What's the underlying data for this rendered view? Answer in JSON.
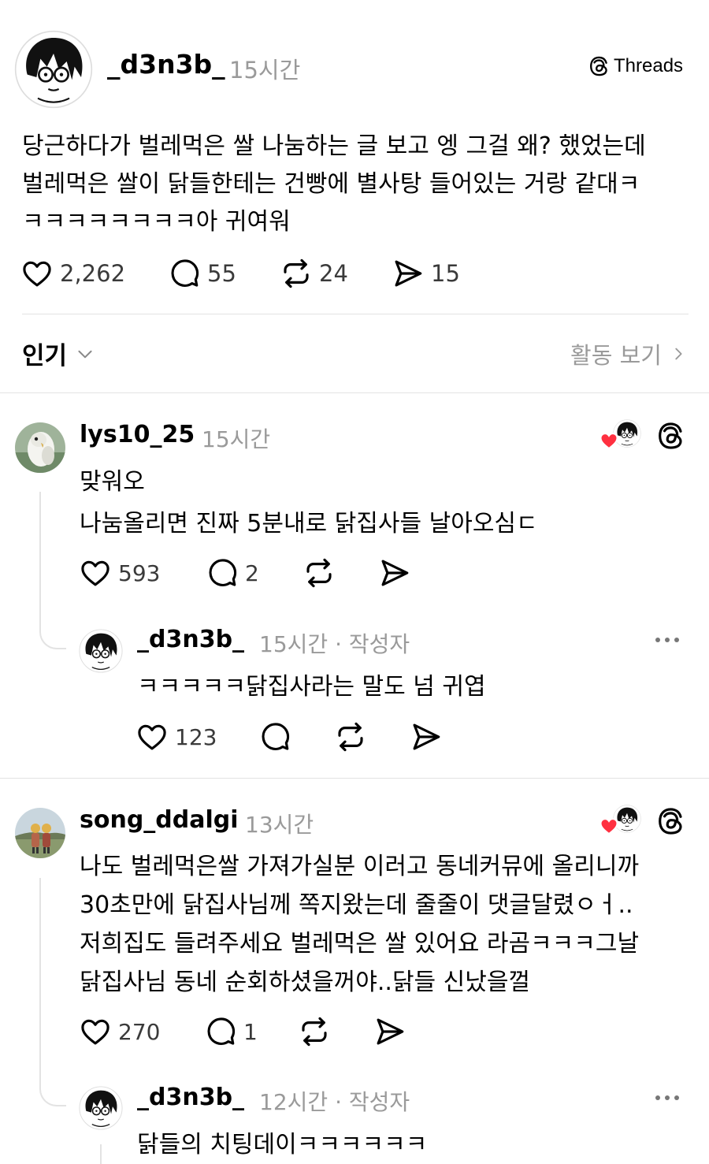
{
  "post": {
    "username": "_d3n3b_",
    "time": "15시간",
    "brand": "Threads",
    "lines": [
      "당근하다가 벌레먹은 쌀 나눔하는 글 보고 엥 그걸 왜? 했었는데",
      "벌레먹은 쌀이 닭들한테는 건빵에 별사탕 들어있는 거랑 같대ㅋ",
      "ㅋㅋㅋㅋㅋㅋㅋㅋ아 귀여워"
    ],
    "likes": "2,262",
    "replies": "55",
    "reposts": "24",
    "shares": "15"
  },
  "sort": {
    "label": "인기",
    "activity_link": "활동 보기"
  },
  "comments": [
    {
      "username": "lys10_25",
      "time": "15시간",
      "lines": [
        "맞워오",
        "나눔올리면 진짜 5분내로 닭집사들 날아오심ㄷ"
      ],
      "likes": "593",
      "replies": "2",
      "reply": {
        "username": "_d3n3b_",
        "time": "15시간",
        "author_tag": "· 작성자",
        "lines": [
          "ㅋㅋㅋㅋㅋ닭집사라는 말도 넘 귀엽"
        ],
        "likes": "123"
      }
    },
    {
      "username": "song_ddalgi",
      "time": "13시간",
      "lines": [
        "나도 벌레먹은쌀 가져가실분 이러고 동네커뮤에 올리니까",
        "30초만에 닭집사님께 쪽지왔는데 줄줄이 댓글달렸ㅇㅓ..",
        "저희집도 들려주세요 벌레먹은 쌀 있어요 라곰ㅋㅋㅋ그날",
        "닭집사님 동네 순회하셨을꺼야..닭들 신났을껄"
      ],
      "likes": "270",
      "replies": "1",
      "reply": {
        "username": "_d3n3b_",
        "time": "12시간",
        "author_tag": "· 작성자",
        "lines": [
          "닭들의 치팅데이ㅋㅋㅋㅋㅋㅋ"
        ]
      }
    }
  ],
  "colors": {
    "text": "#000000",
    "muted": "#9a9a9a",
    "divider": "#e3e3e3",
    "heart": "#ff3040"
  },
  "icons": [
    "heart-icon",
    "comment-icon",
    "repost-icon",
    "share-icon",
    "threads-logo-icon",
    "chevron-down-icon",
    "chevron-right-icon",
    "more-icon"
  ]
}
